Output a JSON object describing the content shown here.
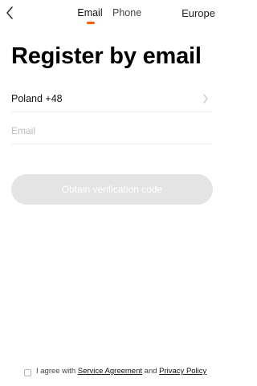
{
  "header": {
    "tabs": [
      {
        "label": "Email",
        "active": true
      },
      {
        "label": "Phone",
        "active": false
      }
    ],
    "region": "Europe",
    "accent_color": "#ff5a0a"
  },
  "page": {
    "title": "Register by email"
  },
  "form": {
    "country": "Poland +48",
    "email_value": "",
    "email_placeholder": "Email",
    "obtain_code_label": "Obtain verification code",
    "button_color": "#e4e4e4"
  },
  "agreement": {
    "checked": false,
    "prefix": "I agree with ",
    "service_link": "Service Agreement",
    "connector": " and ",
    "privacy_link": "Privacy Policy"
  },
  "icons": {
    "back": "chevron-left-icon",
    "country_arrow": "chevron-right-icon"
  }
}
